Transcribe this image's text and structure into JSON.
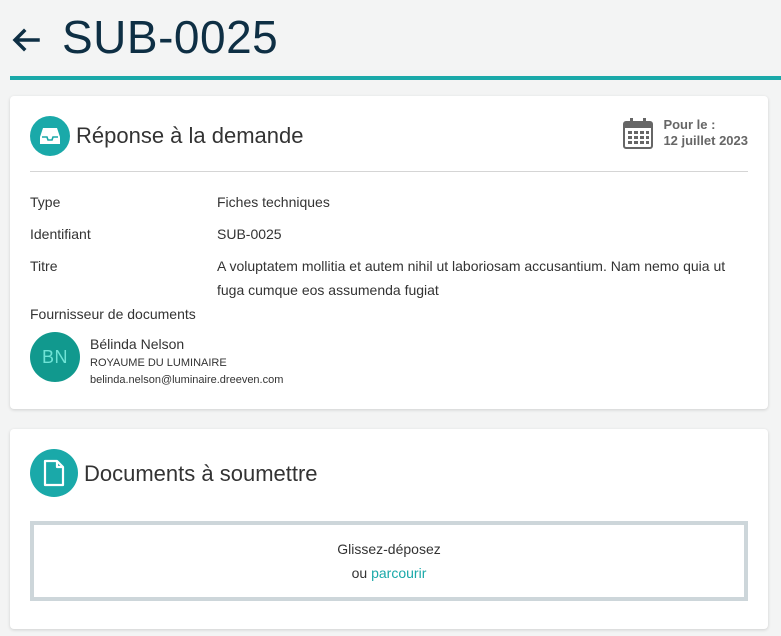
{
  "header": {
    "back_icon": "arrow-left-icon",
    "title": "SUB-0025"
  },
  "response_card": {
    "icon": "inbox-icon",
    "title": "Réponse à la demande",
    "due_icon": "calendar-icon",
    "due_label": "Pour le :",
    "due_date": "12 juillet 2023",
    "fields": [
      {
        "label": "Type",
        "value": "Fiches techniques"
      },
      {
        "label": "Identifiant",
        "value": "SUB-0025"
      },
      {
        "label": "Titre",
        "value": "A voluptatem mollitia et autem nihil ut laboriosam accusantium. Nam nemo quia ut fuga cumque eos assumenda fugiat"
      }
    ],
    "supplier_label": "Fournisseur de documents",
    "supplier": {
      "initials": "BN",
      "name": "Bélinda Nelson",
      "company": "ROYAUME DU LUMINAIRE",
      "email": "belinda.nelson@luminaire.dreeven.com"
    }
  },
  "documents_card": {
    "icon": "file-icon",
    "title": "Documents à soumettre",
    "dropzone_text": "Glissez-déposez",
    "dropzone_or": "ou",
    "dropzone_link": "parcourir"
  },
  "colors": {
    "accent": "#1aa9a9",
    "title": "#0e2f44",
    "avatar": "#11998e"
  }
}
